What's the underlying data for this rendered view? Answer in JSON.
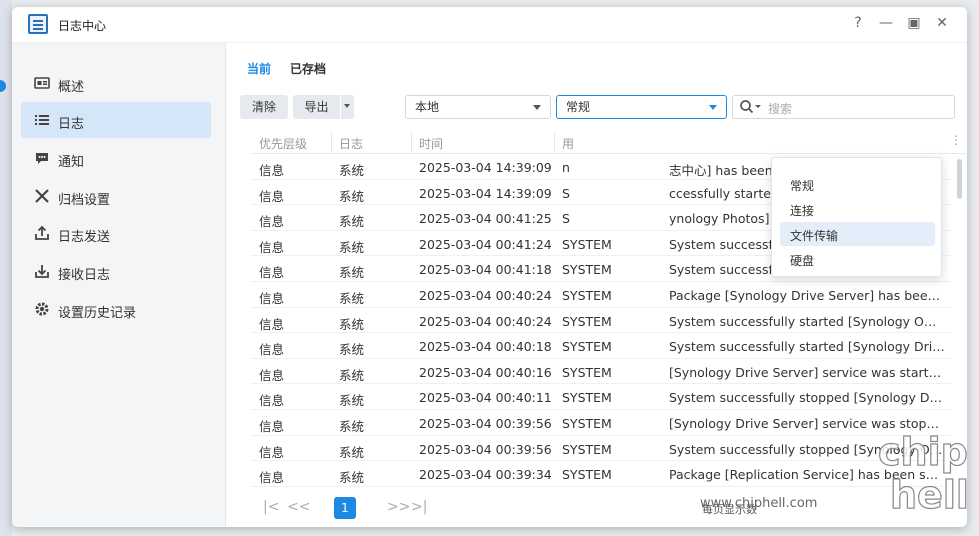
{
  "window": {
    "title": "日志中心",
    "help": "?",
    "minimize": "—",
    "maximize": "▣",
    "close": "✕"
  },
  "sidebar": {
    "items": [
      {
        "label": "概述",
        "icon": "overview-icon"
      },
      {
        "label": "日志",
        "icon": "list-icon"
      },
      {
        "label": "通知",
        "icon": "notification-icon"
      },
      {
        "label": "归档设置",
        "icon": "tools-icon"
      },
      {
        "label": "日志发送",
        "icon": "send-icon"
      },
      {
        "label": "接收日志",
        "icon": "receive-icon"
      },
      {
        "label": "设置历史记录",
        "icon": "gear-icon"
      }
    ],
    "active_index": 1
  },
  "tabs": [
    {
      "label": "当前"
    },
    {
      "label": "已存档"
    }
  ],
  "toolbar": {
    "clear_label": "清除",
    "export_label": "导出",
    "source_select": "本地",
    "type_select": "常规",
    "search_placeholder": "搜索"
  },
  "table": {
    "headers": [
      "优先层级",
      "日志",
      "时间",
      "用",
      ""
    ],
    "rows": [
      [
        "信息",
        "系统",
        "2025-03-04 14:39:09",
        "n",
        "志中心] has been successfully inst..."
      ],
      [
        "信息",
        "系统",
        "2025-03-04 14:39:09",
        "S",
        "ccessfully started [Log Center]."
      ],
      [
        "信息",
        "系统",
        "2025-03-04 00:41:25",
        "S",
        "ynology Photos] has been success..."
      ],
      [
        "信息",
        "系统",
        "2025-03-04 00:41:24",
        "SYSTEM",
        "System successfully started [Synology Photo..."
      ],
      [
        "信息",
        "系统",
        "2025-03-04 00:41:18",
        "SYSTEM",
        "System successfully stopped [Synology Phot..."
      ],
      [
        "信息",
        "系统",
        "2025-03-04 00:40:24",
        "SYSTEM",
        "Package [Synology Drive Server] has been s..."
      ],
      [
        "信息",
        "系统",
        "2025-03-04 00:40:24",
        "SYSTEM",
        "System successfully started [Synology Office]."
      ],
      [
        "信息",
        "系统",
        "2025-03-04 00:40:18",
        "SYSTEM",
        "System successfully started [Synology Drive ..."
      ],
      [
        "信息",
        "系统",
        "2025-03-04 00:40:16",
        "SYSTEM",
        "[Synology Drive Server] service was started."
      ],
      [
        "信息",
        "系统",
        "2025-03-04 00:40:11",
        "SYSTEM",
        "System successfully stopped [Synology Drive..."
      ],
      [
        "信息",
        "系统",
        "2025-03-04 00:39:56",
        "SYSTEM",
        "[Synology Drive Server] service was stopped."
      ],
      [
        "信息",
        "系统",
        "2025-03-04 00:39:56",
        "SYSTEM",
        "System successfully stopped [Synology Offi..."
      ],
      [
        "信息",
        "系统",
        "2025-03-04 00:39:34",
        "SYSTEM",
        "Package [Replication Service] has been succ..."
      ]
    ]
  },
  "type_dropdown": {
    "options": [
      "常规",
      "连接",
      "文件传输",
      "硬盘"
    ],
    "highlighted_index": 2
  },
  "pager": {
    "first": "|<",
    "prev": "<<",
    "current_page": "1",
    "next": ">>",
    "last": ">|",
    "per_page_label": "每页显示数"
  },
  "watermark": {
    "text": "www.chiphell.com",
    "logo": "chip hell"
  },
  "colors": {
    "accent": "#1e88e5",
    "sidebar_active": "#d5e6f8"
  }
}
